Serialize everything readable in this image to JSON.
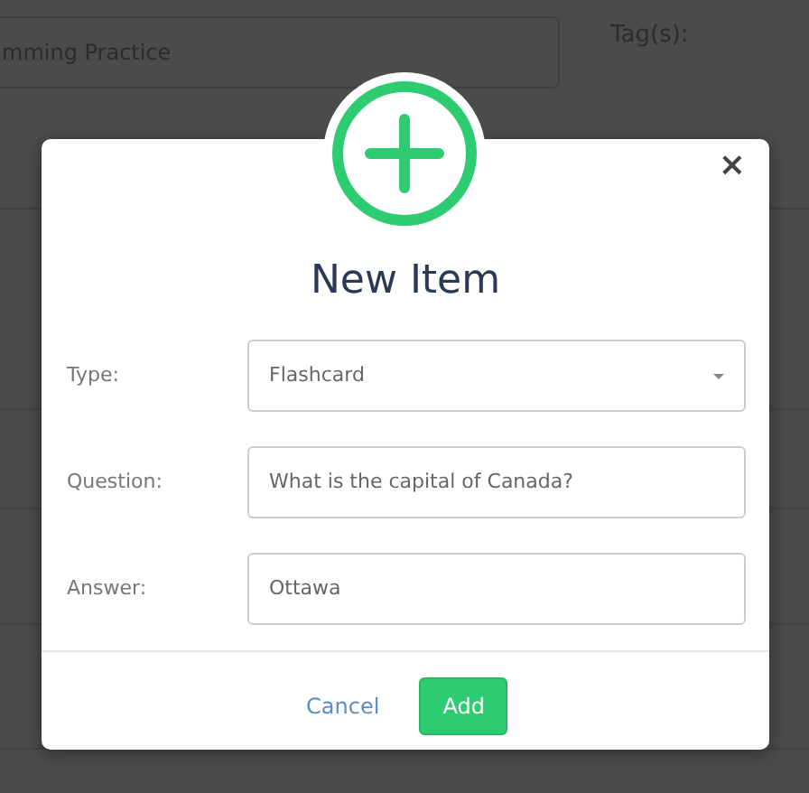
{
  "background": {
    "field_value": "mming Practice",
    "tags_label": "Tag(s):"
  },
  "modal": {
    "title": "New Item",
    "close": "×",
    "fields": [
      {
        "kind": "select",
        "label": "Type:",
        "value": "Flashcard"
      },
      {
        "kind": "text",
        "label": "Question:",
        "value": "What is the capital of Canada?"
      },
      {
        "kind": "text",
        "label": "Answer:",
        "value": "Ottawa"
      }
    ],
    "buttons": [
      {
        "kind": "link",
        "label": "Cancel"
      },
      {
        "kind": "primary",
        "label": "Add"
      }
    ]
  }
}
